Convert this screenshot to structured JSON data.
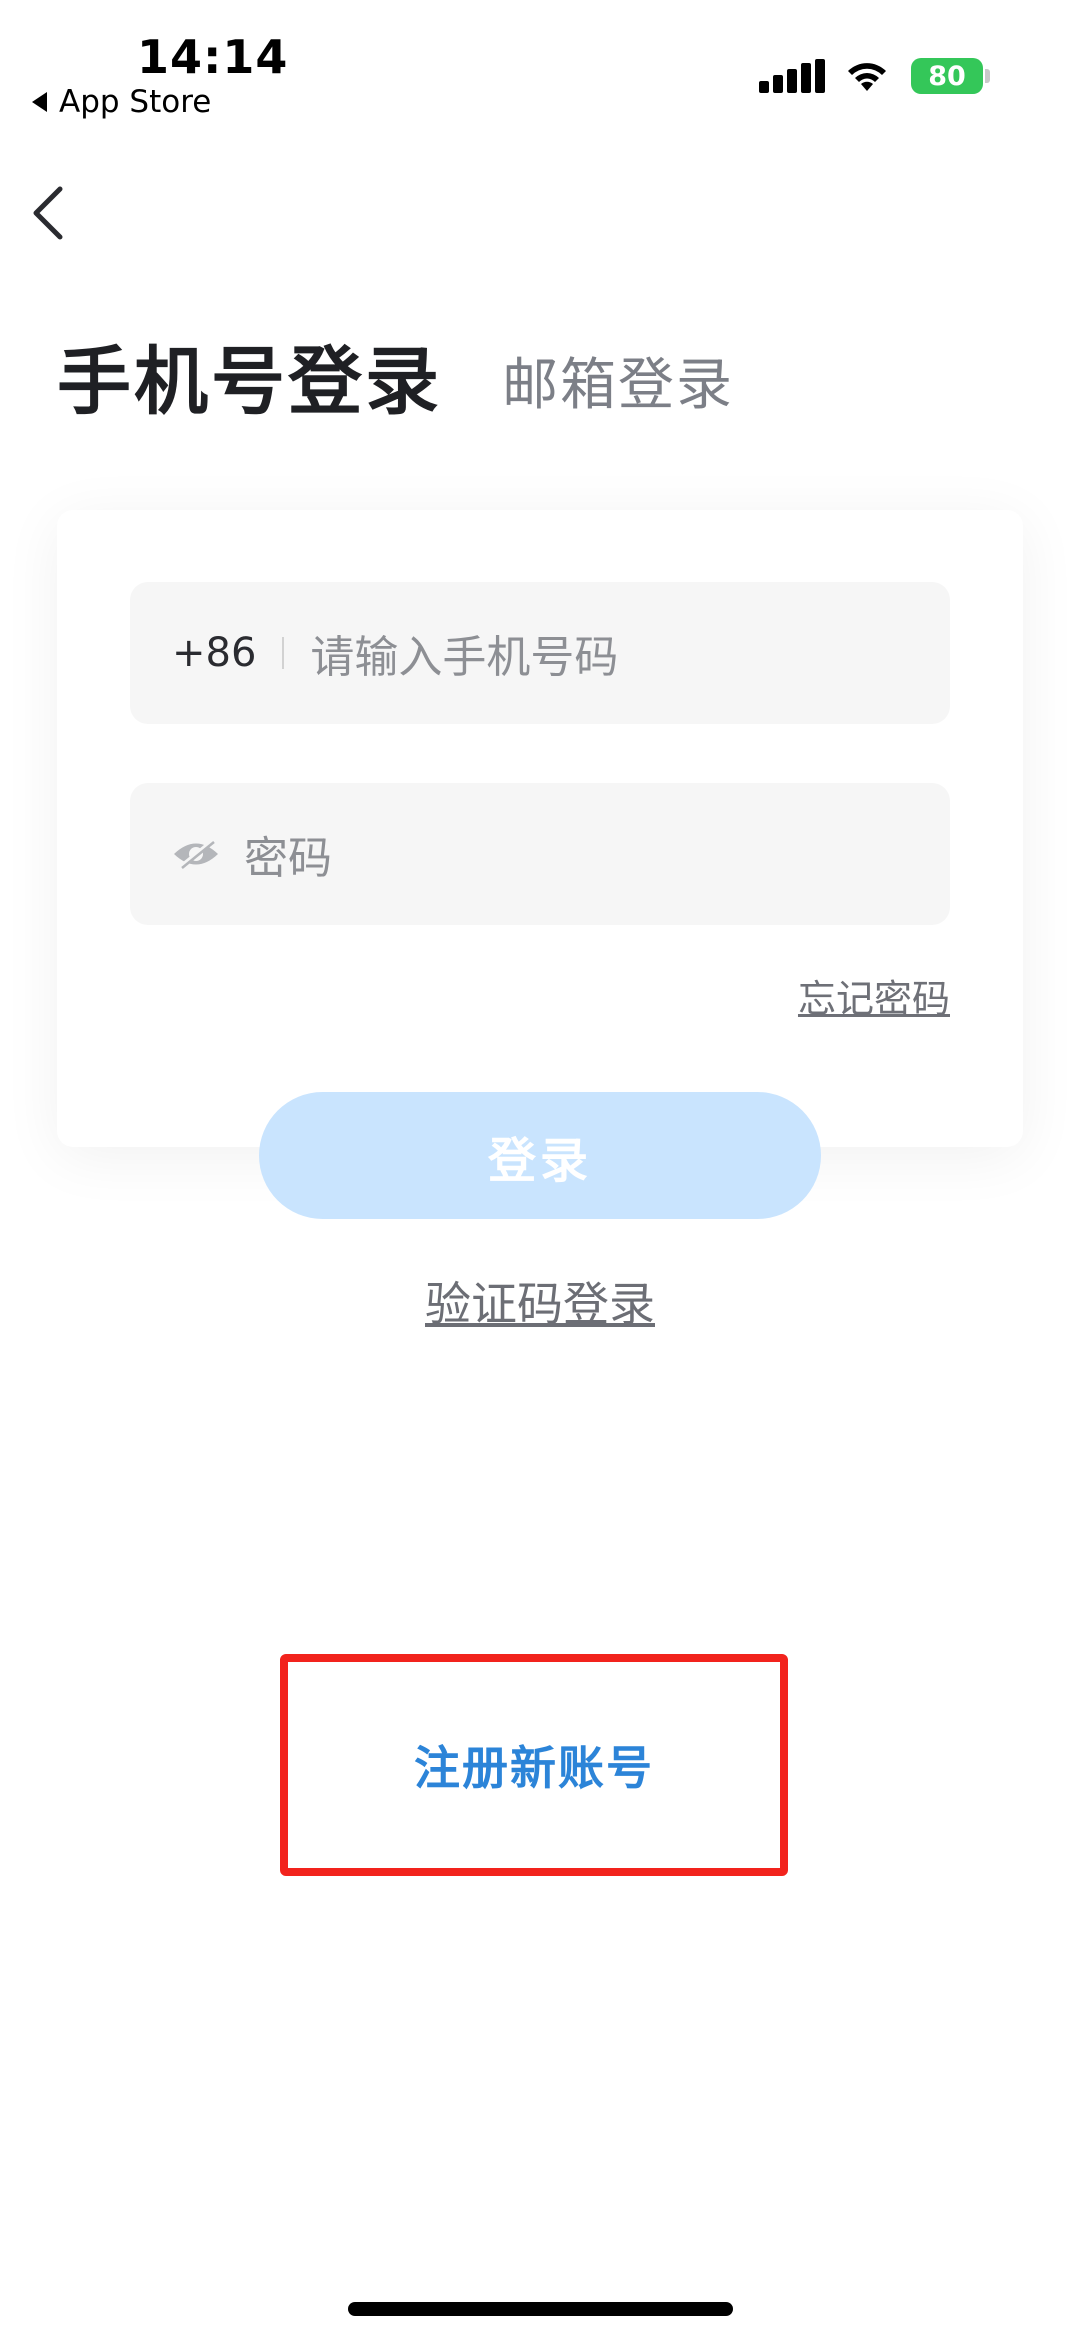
{
  "status_bar": {
    "time": "14:14",
    "back_app_label": "App Store",
    "battery_level": "80",
    "battery_color": "#34c759"
  },
  "nav": {
    "back_icon": "chevron-left-icon"
  },
  "tabs": {
    "active_label": "手机号登录",
    "inactive_label": "邮箱登录"
  },
  "form": {
    "country_code": "+86",
    "phone_placeholder": "请输入手机号码",
    "password_placeholder": "密码",
    "eye_icon": "eye-off-icon",
    "forgot_label": "忘记密码"
  },
  "login_button": {
    "label": "登录",
    "color": "#c9e4fe"
  },
  "code_login_label": "验证码登录",
  "register": {
    "label": "注册新账号",
    "highlight_color": "#f2231d",
    "text_color": "#2c84d8"
  }
}
